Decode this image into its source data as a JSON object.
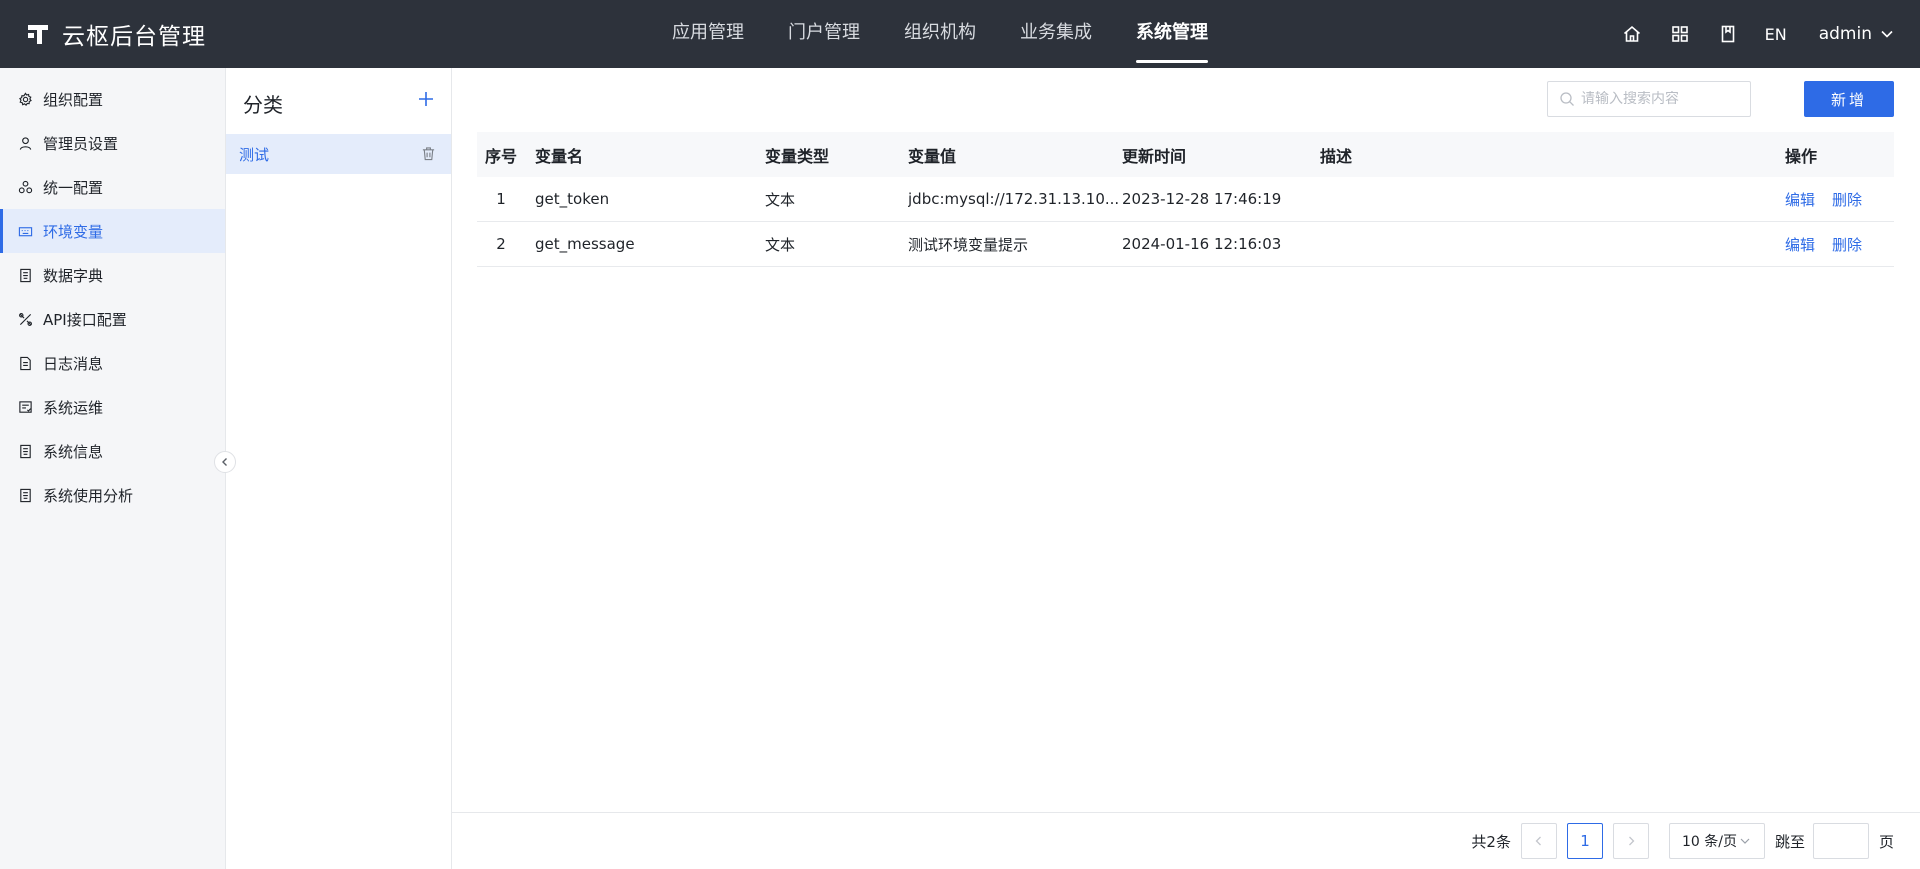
{
  "app": {
    "title": "云枢后台管理"
  },
  "topnav": {
    "items": [
      {
        "label": "应用管理",
        "active": false
      },
      {
        "label": "门户管理",
        "active": false
      },
      {
        "label": "组织机构",
        "active": false
      },
      {
        "label": "业务集成",
        "active": false
      },
      {
        "label": "系统管理",
        "active": true
      }
    ]
  },
  "topright": {
    "icons": [
      "home-icon",
      "grid-icon",
      "book-icon"
    ],
    "lang": "EN",
    "user": "admin"
  },
  "sidebar": {
    "items": [
      {
        "label": "组织配置",
        "icon": "gear-icon",
        "active": false
      },
      {
        "label": "管理员设置",
        "icon": "user-icon",
        "active": false
      },
      {
        "label": "统一配置",
        "icon": "cluster-icon",
        "active": false
      },
      {
        "label": "环境变量",
        "icon": "keyboard-icon",
        "active": true
      },
      {
        "label": "数据字典",
        "icon": "document-icon",
        "active": false
      },
      {
        "label": "API接口配置",
        "icon": "tools-icon",
        "active": false
      },
      {
        "label": "日志消息",
        "icon": "file-text-icon",
        "active": false
      },
      {
        "label": "系统运维",
        "icon": "monitor-icon",
        "active": false
      },
      {
        "label": "系统信息",
        "icon": "info-doc-icon",
        "active": false
      },
      {
        "label": "系统使用分析",
        "icon": "analysis-icon",
        "active": false
      }
    ]
  },
  "category": {
    "title": "分类",
    "items": [
      {
        "label": "测试",
        "active": true
      }
    ]
  },
  "search": {
    "placeholder": "请输入搜索内容",
    "value": ""
  },
  "toolbar": {
    "add_label": "新增"
  },
  "table": {
    "headers": {
      "idx": "序号",
      "name": "变量名",
      "type": "变量类型",
      "value": "变量值",
      "time": "更新时间",
      "desc": "描述",
      "ops": "操作"
    },
    "rows": [
      {
        "idx": "1",
        "name": "get_token",
        "type": "文本",
        "value": "jdbc:mysql://172.31.13.10...",
        "time": "2023-12-28 17:46:19",
        "desc": "",
        "edit": "编辑",
        "delete": "删除"
      },
      {
        "idx": "2",
        "name": "get_message",
        "type": "文本",
        "value": "测试环境变量提示",
        "time": "2024-01-16 12:16:03",
        "desc": "",
        "edit": "编辑",
        "delete": "删除"
      }
    ]
  },
  "pagination": {
    "total": "共2条",
    "current_page": "1",
    "page_size": "10 条/页",
    "jump_label": "跳至",
    "jump_value": "",
    "page_suffix": "页"
  },
  "colors": {
    "topbar": "#2d323b",
    "accent": "#2e6be6",
    "sidebar_bg": "#f5f6f8",
    "active_bg": "#e4ecfb"
  }
}
